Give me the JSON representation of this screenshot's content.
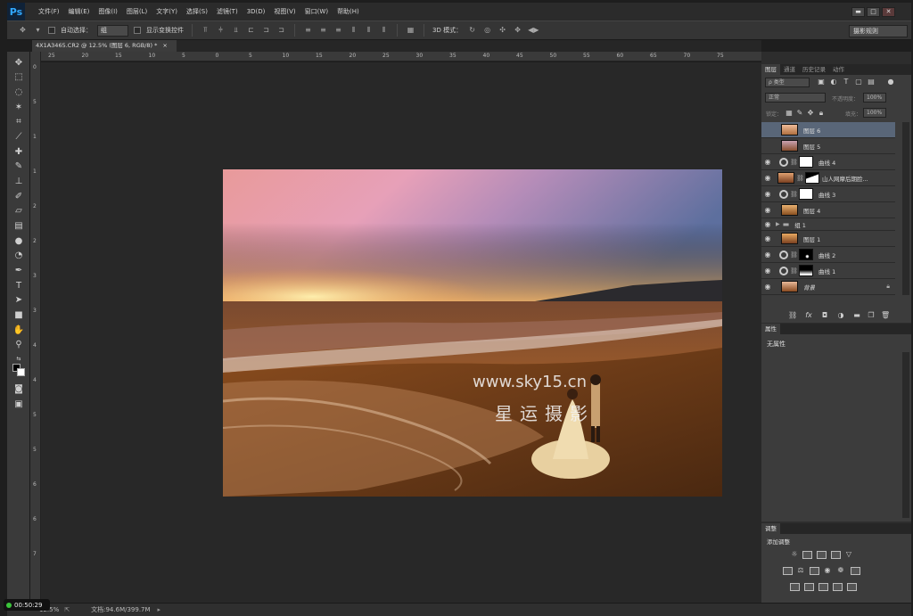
{
  "app": {
    "logo": "Ps"
  },
  "menu": [
    "文件(F)",
    "编辑(E)",
    "图像(I)",
    "图层(L)",
    "文字(Y)",
    "选择(S)",
    "滤镜(T)",
    "3D(D)",
    "视图(V)",
    "窗口(W)",
    "帮助(H)"
  ],
  "window_controls": [
    "▬",
    "□",
    "✕"
  ],
  "options": {
    "auto_select_label": "自动选择：",
    "auto_select_value": "组",
    "show_transform_label": "显示变换控件",
    "mode_3d_label": "3D 模式：",
    "workspace": "摄影规则"
  },
  "document_tab": {
    "title": "4X1A3465.CR2 @ 12.5% (图层 6, RGB/8) *",
    "close": "×"
  },
  "rulers": {
    "top": [
      "25",
      "20",
      "15",
      "10",
      "5",
      "0",
      "5",
      "10",
      "15",
      "20",
      "25",
      "30",
      "35",
      "40",
      "45",
      "50",
      "55",
      "60",
      "65",
      "70",
      "75"
    ],
    "left": [
      "0",
      "5",
      "1",
      "1",
      "2",
      "2",
      "3",
      "3",
      "4",
      "4",
      "5",
      "5",
      "6",
      "6",
      "7"
    ]
  },
  "photo": {
    "watermark_url": "www.sky15.cn",
    "watermark_brand": "星运摄影"
  },
  "status": {
    "zoom": "12.5%",
    "doc_size": "文档:94.6M/399.7M",
    "timer": "00:50:29",
    "timer_color": "#3ac43a"
  },
  "layers_panel": {
    "tabs": [
      "图层",
      "通道",
      "历史记录",
      "动作"
    ],
    "filter_label": "ρ 类型",
    "blend_mode": "正常",
    "opacity_label": "不透明度：",
    "opacity_value": "100%",
    "lock_label": "锁定：",
    "fill_label": "填充：",
    "fill_value": "100%",
    "selected_color": "#596678",
    "layers": [
      {
        "name": "图层 6",
        "visible": false,
        "selected": true
      },
      {
        "name": "图层 5",
        "visible": false
      },
      {
        "name": "曲线 4",
        "visible": true
      },
      {
        "name": "山人网摩后期脸...",
        "visible": true
      },
      {
        "name": "曲线 3",
        "visible": true
      },
      {
        "name": "图层 4",
        "visible": true
      },
      {
        "name": "组 1",
        "visible": true
      },
      {
        "name": "图层 1",
        "visible": true
      },
      {
        "name": "曲线 2",
        "visible": true
      },
      {
        "name": "曲线 1",
        "visible": true
      },
      {
        "name": "背景",
        "visible": true
      }
    ],
    "footer_icons": [
      "link-icon",
      "fx-icon",
      "mask-icon",
      "adjustment-icon",
      "folder-icon",
      "new-layer-icon",
      "trash-icon"
    ]
  },
  "properties_panel": {
    "tab": "属性",
    "content": "无属性"
  },
  "adjustments_panel": {
    "tab": "调整",
    "title": "添加调整"
  }
}
